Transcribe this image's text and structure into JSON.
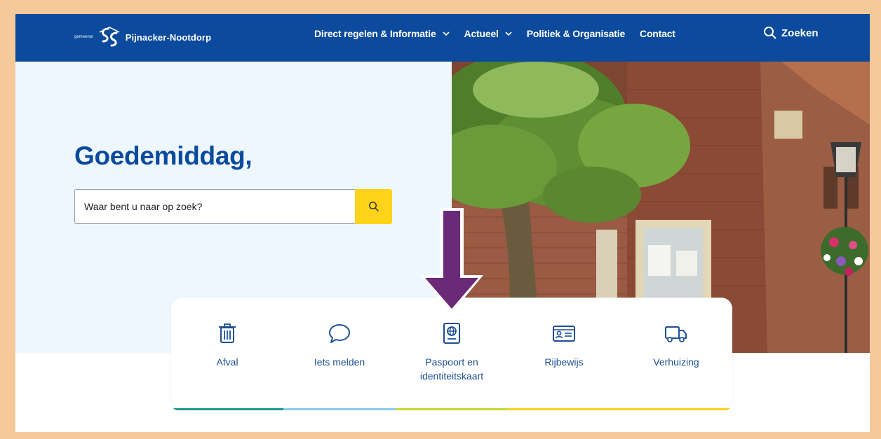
{
  "header": {
    "logo_prefix": "gemeente",
    "logo_name": "Pijnacker-Nootdorp",
    "nav": [
      {
        "label": "Direct regelen & Informatie",
        "has_dropdown": true
      },
      {
        "label": "Actueel",
        "has_dropdown": true
      },
      {
        "label": "Politiek & Organisatie",
        "has_dropdown": false
      },
      {
        "label": "Contact",
        "has_dropdown": false
      }
    ],
    "search_label": "Zoeken"
  },
  "hero": {
    "greeting": "Goedemiddag,",
    "search_placeholder": "Waar bent u naar op zoek?"
  },
  "tiles": [
    {
      "label": "Afval",
      "icon": "trash-bin-icon"
    },
    {
      "label": "Iets melden",
      "icon": "speech-bubble-icon"
    },
    {
      "label": "Paspoort en identiteitskaart",
      "icon": "passport-icon"
    },
    {
      "label": "Rijbewijs",
      "icon": "id-card-icon"
    },
    {
      "label": "Verhuizing",
      "icon": "moving-truck-icon"
    }
  ],
  "colors": {
    "brand_blue": "#0b4a9c",
    "search_yellow": "#ffd31a",
    "hero_background": "#eef7fd",
    "page_border": "#f6c99a",
    "annotation_arrow": "#6b2a78"
  },
  "annotation": {
    "type": "arrow-down",
    "points_to": "Paspoort en identiteitskaart"
  }
}
